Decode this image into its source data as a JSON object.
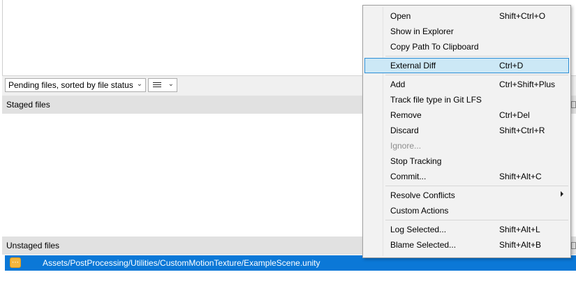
{
  "toolbar": {
    "sort_dropdown_label": "Pending files, sorted by file status",
    "view_dropdown_icon": "list-view-icon"
  },
  "staged": {
    "header": "Staged files"
  },
  "unstaged": {
    "header": "Unstaged files"
  },
  "files": [
    {
      "path": "Assets/PostProcessing/Utilities/CustomMotionTexture/ExampleScene.unity",
      "status_icon": "modified-file-icon",
      "status_color": "#f4b63d",
      "selected": true
    }
  ],
  "colors": {
    "selection": "#0b78d7",
    "menu_highlight": "#cce8f6",
    "menu_highlight_border": "#2c8ed6",
    "section_header": "#e1e1e1"
  },
  "context_menu": {
    "open": {
      "label": "Open",
      "shortcut": "Shift+Ctrl+O"
    },
    "show_in_explorer": {
      "label": "Show in Explorer"
    },
    "copy_path": {
      "label": "Copy Path To Clipboard"
    },
    "external_diff": {
      "label": "External Diff",
      "shortcut": "Ctrl+D",
      "highlighted": true
    },
    "add": {
      "label": "Add",
      "shortcut": "Ctrl+Shift+Plus"
    },
    "track_lfs": {
      "label": "Track file type in Git LFS"
    },
    "remove": {
      "label": "Remove",
      "shortcut": "Ctrl+Del"
    },
    "discard": {
      "label": "Discard",
      "shortcut": "Shift+Ctrl+R"
    },
    "ignore": {
      "label": "Ignore...",
      "disabled": true
    },
    "stop_tracking": {
      "label": "Stop Tracking"
    },
    "commit": {
      "label": "Commit...",
      "shortcut": "Shift+Alt+C"
    },
    "resolve_conflicts": {
      "label": "Resolve Conflicts",
      "has_submenu": true
    },
    "custom_actions": {
      "label": "Custom Actions"
    },
    "log_selected": {
      "label": "Log Selected...",
      "shortcut": "Shift+Alt+L"
    },
    "blame_selected": {
      "label": "Blame Selected...",
      "shortcut": "Shift+Alt+B"
    }
  }
}
